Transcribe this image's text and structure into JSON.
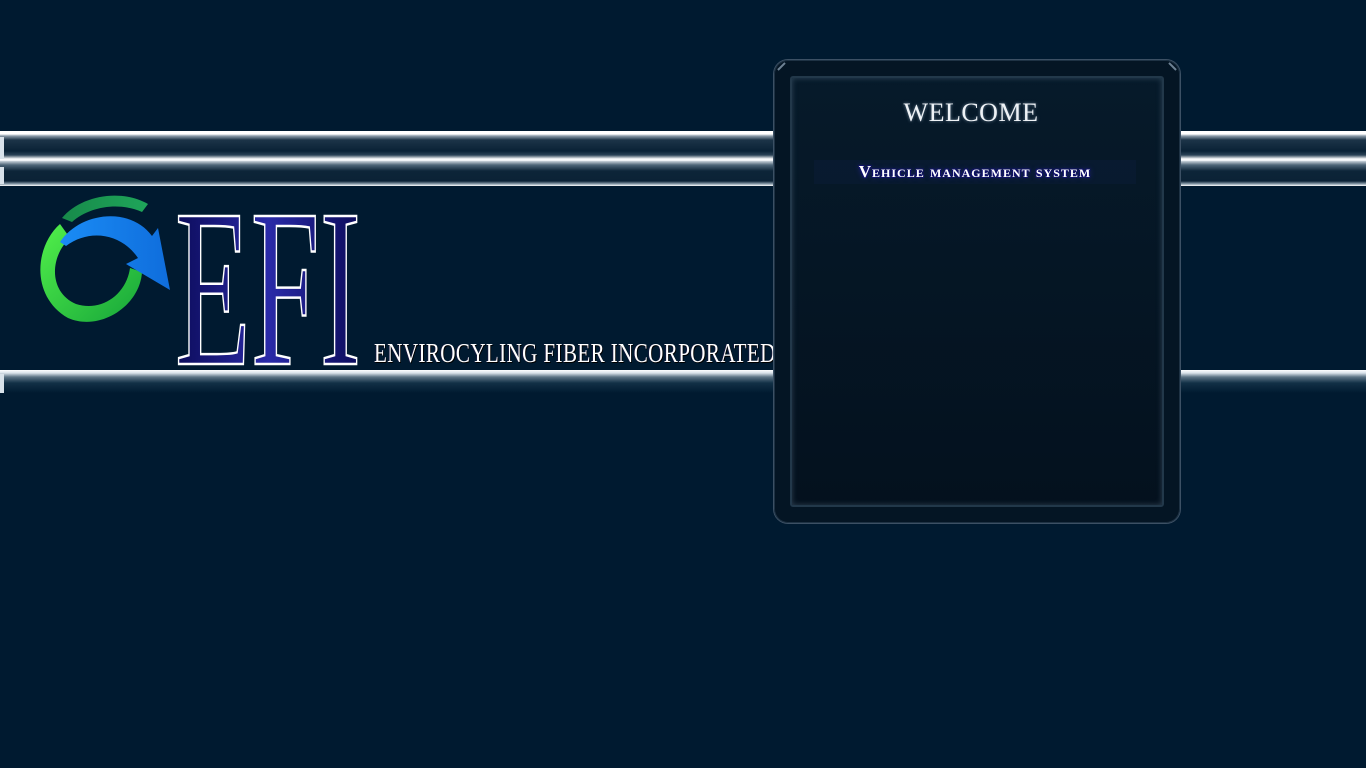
{
  "header": {
    "logo_letters": "EFI",
    "company_name": "ENVIROCYLING FIBER INCORPORATED"
  },
  "panel": {
    "title": "WELCOME",
    "subtitle": "Vehicle management system"
  },
  "colors": {
    "background": "#001a30",
    "stripe": "#ffffff",
    "logo_green": "#2bd13a",
    "logo_blue": "#1a82f0",
    "logo_letters": "#1c1c8a"
  },
  "icons": {
    "logo_mark": "recycle-arrows-icon"
  }
}
